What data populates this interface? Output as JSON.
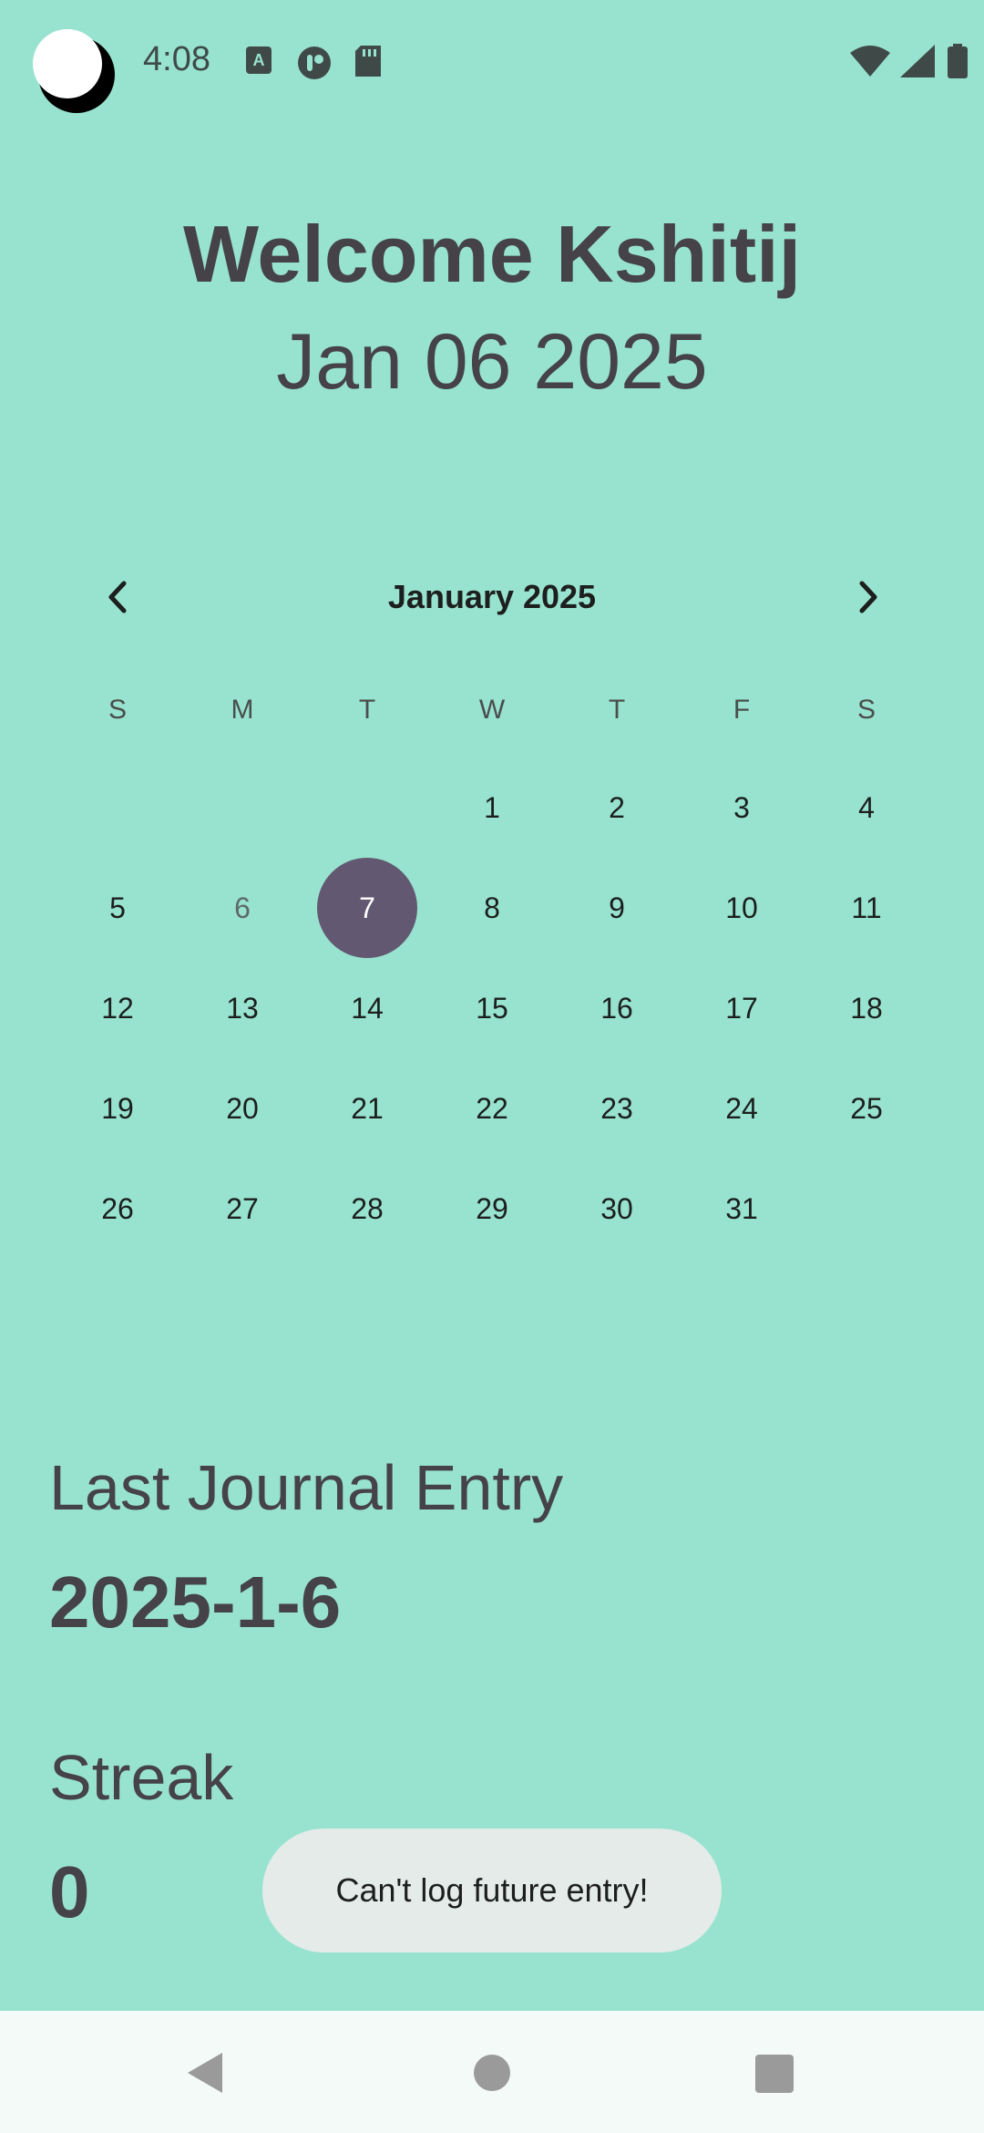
{
  "status_bar": {
    "time": "4:08",
    "left_icons": [
      "moon-app-icon",
      "a-keyboard-icon",
      "sync-icon",
      "sd-card-icon"
    ],
    "right_icons": [
      "wifi-icon",
      "signal-icon",
      "battery-icon"
    ]
  },
  "header": {
    "welcome": "Welcome Kshitij",
    "date": "Jan 06 2025"
  },
  "calendar": {
    "month_label": "January 2025",
    "prev_icon": "chevron-left-icon",
    "next_icon": "chevron-right-icon",
    "weekdays": [
      "S",
      "M",
      "T",
      "W",
      "T",
      "F",
      "S"
    ],
    "days": [
      "1",
      "2",
      "3",
      "4",
      "5",
      "6",
      "7",
      "8",
      "9",
      "10",
      "11",
      "12",
      "13",
      "14",
      "15",
      "16",
      "17",
      "18",
      "19",
      "20",
      "21",
      "22",
      "23",
      "24",
      "25",
      "26",
      "27",
      "28",
      "29",
      "30",
      "31"
    ],
    "first_weekday_index": 3,
    "selected_day": "7",
    "today_day": "6"
  },
  "journal": {
    "last_entry_label": "Last Journal Entry",
    "last_entry_value": "2025-1-6",
    "streak_label": "Streak",
    "streak_value": "0"
  },
  "toast": {
    "message": "Can't log future entry!"
  },
  "nav_bar": {
    "icons": [
      "back-icon",
      "home-icon",
      "recents-icon"
    ]
  },
  "colors": {
    "background": "#98e3cf",
    "selected_day": "#635871",
    "text": "#454248",
    "toast_bg": "#e5ebe9",
    "nav_bar_bg": "#f3faf8"
  }
}
